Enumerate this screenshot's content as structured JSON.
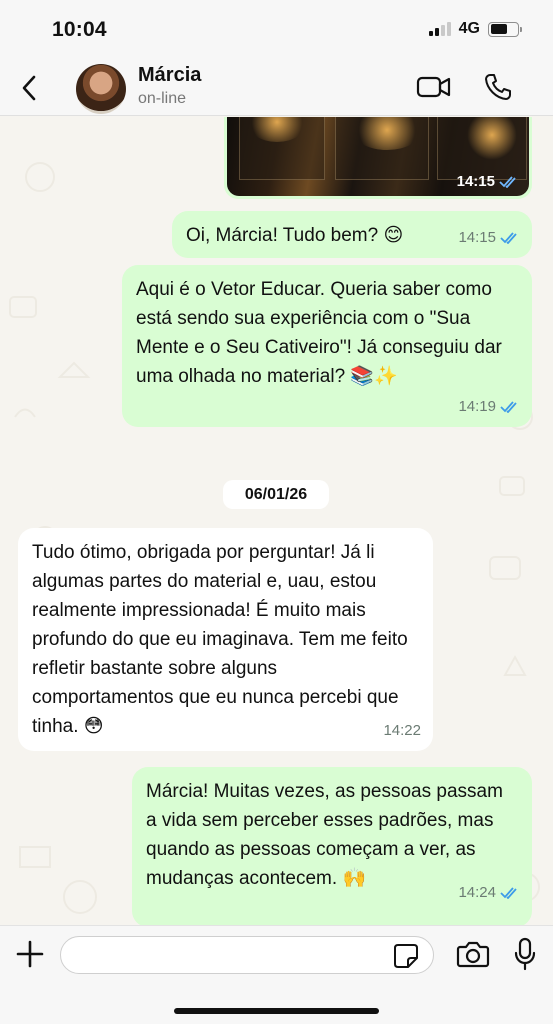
{
  "status_bar": {
    "time": "10:04",
    "network": "4G"
  },
  "header": {
    "name": "Márcia",
    "status": "on-line"
  },
  "messages": [
    {
      "type": "image",
      "time": "14:15"
    },
    {
      "type": "out",
      "text": "Oi, Márcia! Tudo bem? 😊",
      "time": "14:15"
    },
    {
      "type": "out",
      "text": "Aqui é o Vetor Educar. Queria saber como está sendo sua experiência com o \"Sua Mente e o Seu Cativeiro\"! Já conseguiu dar uma olhada no material? 📚✨",
      "time": "14:19"
    },
    {
      "type": "in",
      "text": "Tudo ótimo, obrigada por perguntar! Já li algumas partes do material e, uau, estou realmente impressionada! É muito mais profundo do que eu imaginava. Tem me feito refletir bastante sobre alguns comportamentos que eu nunca percebi que tinha. 😳",
      "time": "14:22"
    },
    {
      "type": "out",
      "text": "Márcia! Muitas vezes, as pessoas passam a vida sem perceber esses padrões, mas quando as pessoas começam a ver, as mudanças acontecem. 🙌",
      "time": "14:24"
    }
  ],
  "date_divider": "06/01/26",
  "input": {
    "placeholder": ""
  },
  "icons": [
    "back-icon",
    "video-call-icon",
    "phone-icon",
    "plus-icon",
    "sticker-icon",
    "camera-icon",
    "mic-icon",
    "double-check-icon"
  ],
  "colors": {
    "outgoing_bubble": "#d9fdd3",
    "incoming_bubble": "#ffffff",
    "read_ticks": "#3d9be9",
    "wallpaper": "#f6f4ef"
  }
}
